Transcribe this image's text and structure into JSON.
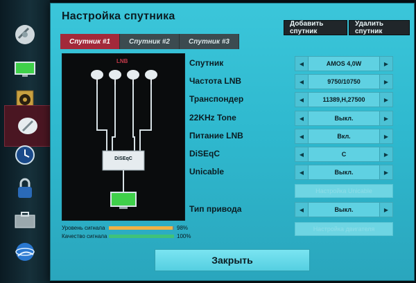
{
  "dialog": {
    "title": "Настройка спутника",
    "add_button": "Добавить спутник",
    "delete_button": "Удалить спутник",
    "close_button": "Закрыть"
  },
  "tabs": [
    {
      "label": "Спутник #1",
      "active": true
    },
    {
      "label": "Спутник #2",
      "active": false
    },
    {
      "label": "Спутник #3",
      "active": false
    }
  ],
  "diagram": {
    "lnb_label": "LNB",
    "switch_label": "DiSEqC"
  },
  "signal": {
    "level_label": "Уровень сигнала",
    "level_value": "98%",
    "level_fraction": 0.98,
    "quality_label": "Качество сигнала",
    "quality_value": "100%",
    "quality_fraction": 1.0
  },
  "settings": [
    {
      "label": "Спутник",
      "value": "AMOS 4,0W"
    },
    {
      "label": "Частота LNB",
      "value": "9750/10750"
    },
    {
      "label": "Транспондер",
      "value": "11389,H,27500"
    },
    {
      "label": "22KHz Tone",
      "value": "Выкл."
    },
    {
      "label": "Питание LNB",
      "value": "Вкл."
    },
    {
      "label": "DiSEqC",
      "value": "C"
    },
    {
      "label": "Unicable",
      "value": "Выкл."
    },
    {
      "label": "Тип привода",
      "value": "Выкл."
    }
  ],
  "disabled_buttons": {
    "unicable_setup": "Настройка Unicable",
    "motor_setup": "Настройка двигателя"
  },
  "side_menu": [
    "satellite-icon",
    "tv-screen-icon",
    "speaker-icon",
    "satellite-dish-icon",
    "clock-icon",
    "lock-icon",
    "briefcase-icon",
    "globe-icon"
  ],
  "colors": {
    "accent_tab": "#a3293a",
    "level_bar": "#f0b245",
    "quality_bar": "#3fc27a"
  }
}
